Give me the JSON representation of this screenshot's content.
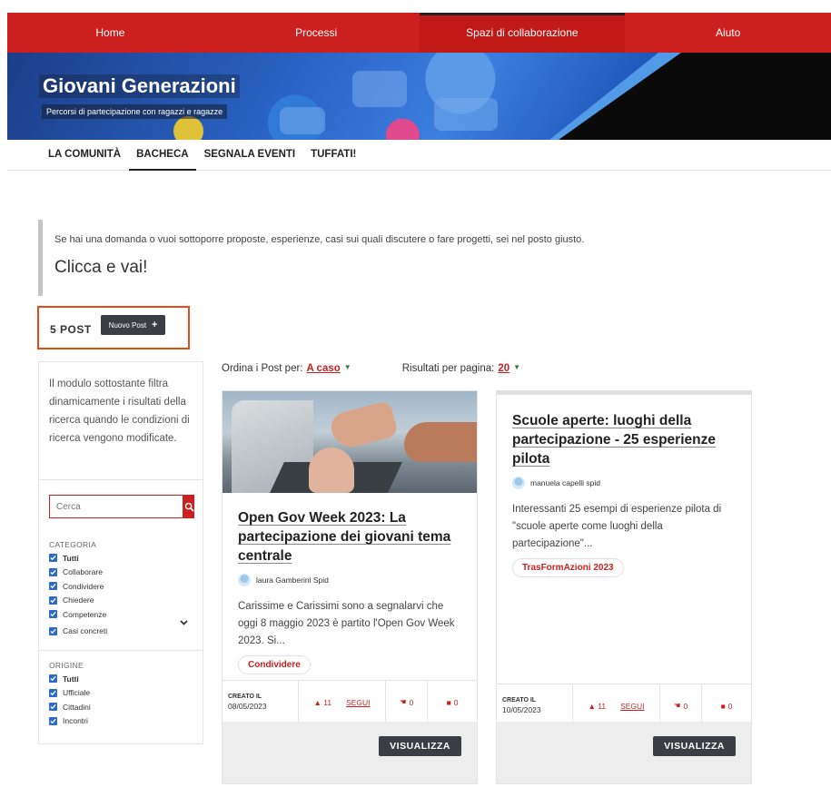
{
  "topnav": {
    "items": [
      {
        "label": "Home"
      },
      {
        "label": "Processi"
      },
      {
        "label": "Spazi di collaborazione"
      },
      {
        "label": "Aiuto"
      }
    ]
  },
  "banner": {
    "title": "Giovani Generazioni",
    "subtitle": "Percorsi di partecipazione con ragazzi e ragazze"
  },
  "subnav": {
    "tabs": [
      {
        "label": "LA COMUNITÀ"
      },
      {
        "label": "BACHECA"
      },
      {
        "label": "SEGNALA EVENTI"
      },
      {
        "label": "TUFFATI!"
      }
    ]
  },
  "intro": {
    "lead": "Se hai una domanda o vuoi sottoporre proposte, esperienze, casi sui quali discutere o fare progetti, sei nel posto giusto.",
    "cta": "Clicca e vai!"
  },
  "posts": {
    "count_label": "5 POST",
    "new_post_label": "Nuovo Post"
  },
  "sidebar": {
    "info": "Il modulo sottostante filtra dinamicamente i risultati della ricerca quando le condizioni di ricerca vengono modificate.",
    "search_placeholder": "Cerca",
    "category_label": "CATEGORIA",
    "categories": [
      "Tutti",
      "Collaborare",
      "Condividere",
      "Chiedere",
      "Competenze",
      "Casi concreti"
    ],
    "origin_label": "ORIGINE",
    "origins": [
      "Tutti",
      "Ufficiale",
      "Cittadini",
      "Incontri"
    ]
  },
  "sort": {
    "order_label": "Ordina i Post per:",
    "order_value": "A caso",
    "per_page_label": "Risultati per pagina:",
    "per_page_value": "20"
  },
  "cards": [
    {
      "title": "Open Gov Week 2023: La partecipazione dei giovani tema centrale",
      "author": "laura Gamberini Spid",
      "excerpt": "Carissime e Carissimi sono a segnalarvi che oggi 8 maggio 2023 è partito l'Open Gov Week 2023. Si...",
      "tag": "Condividere",
      "created_label": "CREATO IL",
      "created_date": "08/05/2023",
      "followers": "11",
      "follow_label": "SEGUI",
      "likes": "0",
      "comments": "0",
      "view_label": "VISUALIZZA"
    },
    {
      "title": "Scuole aperte: luoghi della partecipazione - 25 esperienze pilota",
      "author": "manuela capelli spid",
      "excerpt": "Interessanti 25 esempi di esperienze pilota di \"scuole aperte come luoghi della partecipazione\"...",
      "tag": "TrasFormAzioni 2023",
      "created_label": "CREATO IL",
      "created_date": "10/05/2023",
      "followers": "11",
      "follow_label": "SEGUI",
      "likes": "0",
      "comments": "0",
      "view_label": "VISUALIZZA"
    }
  ],
  "colors": {
    "brand_red": "#cc1f1f",
    "checkbox_blue": "#2c6bc9",
    "dark_button": "#3b3f45",
    "highlight_orange": "#e64a19"
  }
}
